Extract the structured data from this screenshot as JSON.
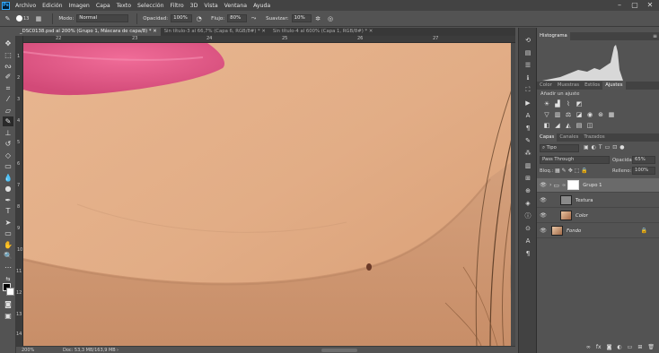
{
  "menubar": {
    "app_icon": "Ps",
    "items": [
      "Archivo",
      "Edición",
      "Imagen",
      "Capa",
      "Texto",
      "Selección",
      "Filtro",
      "3D",
      "Vista",
      "Ventana",
      "Ayuda"
    ]
  },
  "options_bar": {
    "brush_size": "13",
    "modo_label": "Modo:",
    "modo_value": "Normal",
    "opacidad_label": "Opacidad:",
    "opacidad_value": "100%",
    "flujo_label": "Flujo:",
    "flujo_value": "80%",
    "suavizar_label": "Suavizar:",
    "suavizar_value": "10%"
  },
  "document_tabs": [
    {
      "label": "_DSC0138.psd al 200% (Grupo 1, Máscara de capa/8) *",
      "close": "✕",
      "active": true
    },
    {
      "label": "Sin título-3 al 66,7% (Capa 6, RGB/8#) *",
      "close": "✕",
      "active": false
    },
    {
      "label": "Sin título-4 al 600% (Capa 1, RGB/8#) *",
      "close": "✕",
      "active": false
    }
  ],
  "rulers": {
    "top": [
      "22",
      "23",
      "24",
      "25",
      "26",
      "27"
    ],
    "left": [
      "1",
      "2",
      "3",
      "4",
      "5",
      "6",
      "7",
      "8",
      "9",
      "10",
      "11",
      "12",
      "13",
      "14"
    ]
  },
  "status": {
    "zoom": "200%",
    "doc": "Doc: 53,3 MB/163,9 MB"
  },
  "panels": {
    "histogram": {
      "tab": "Histograma",
      "menu_icon": "≡"
    },
    "adjust": {
      "tabs": [
        "Color",
        "Muestras",
        "Estilos",
        "Ajustes"
      ],
      "active": "Ajustes",
      "title": "Añadir un ajuste",
      "icon_rows": [
        [
          "brightness-icon",
          "levels-icon",
          "curves-icon",
          "exposure-icon"
        ],
        [
          "vibrance-icon",
          "hue-sat-icon",
          "color-balance-icon",
          "bw-icon",
          "photo-filter-icon",
          "channel-mixer-icon",
          "color-lookup-icon"
        ],
        [
          "invert-icon",
          "posterize-icon",
          "threshold-icon",
          "gradient-map-icon",
          "selective-color-icon"
        ]
      ]
    },
    "layers": {
      "tabs": [
        "Capas",
        "Canales",
        "Trazados"
      ],
      "active": "Capas",
      "filter_label": "Tipo",
      "blend_mode": "Pass Through",
      "opacidad_label": "Opacidad:",
      "opacidad_value": "65%",
      "bloq_label": "Bloq.:",
      "relleno_label": "Relleno:",
      "relleno_value": "100%",
      "layers": [
        {
          "name": "Grupo 1",
          "visible": true,
          "selected": true,
          "type": "group"
        },
        {
          "name": "Textura",
          "visible": true,
          "selected": false,
          "type": "layer"
        },
        {
          "name": "Color",
          "visible": true,
          "selected": false,
          "type": "layer"
        },
        {
          "name": "Fondo",
          "visible": true,
          "selected": false,
          "type": "background"
        }
      ],
      "footer_fx": "fx"
    }
  },
  "colors": {
    "ui_dark": "#424242",
    "ui_mid": "#535353",
    "selected_layer": "#6a6a6a",
    "skin": "#e6b38c",
    "lips": "#e45a86"
  }
}
